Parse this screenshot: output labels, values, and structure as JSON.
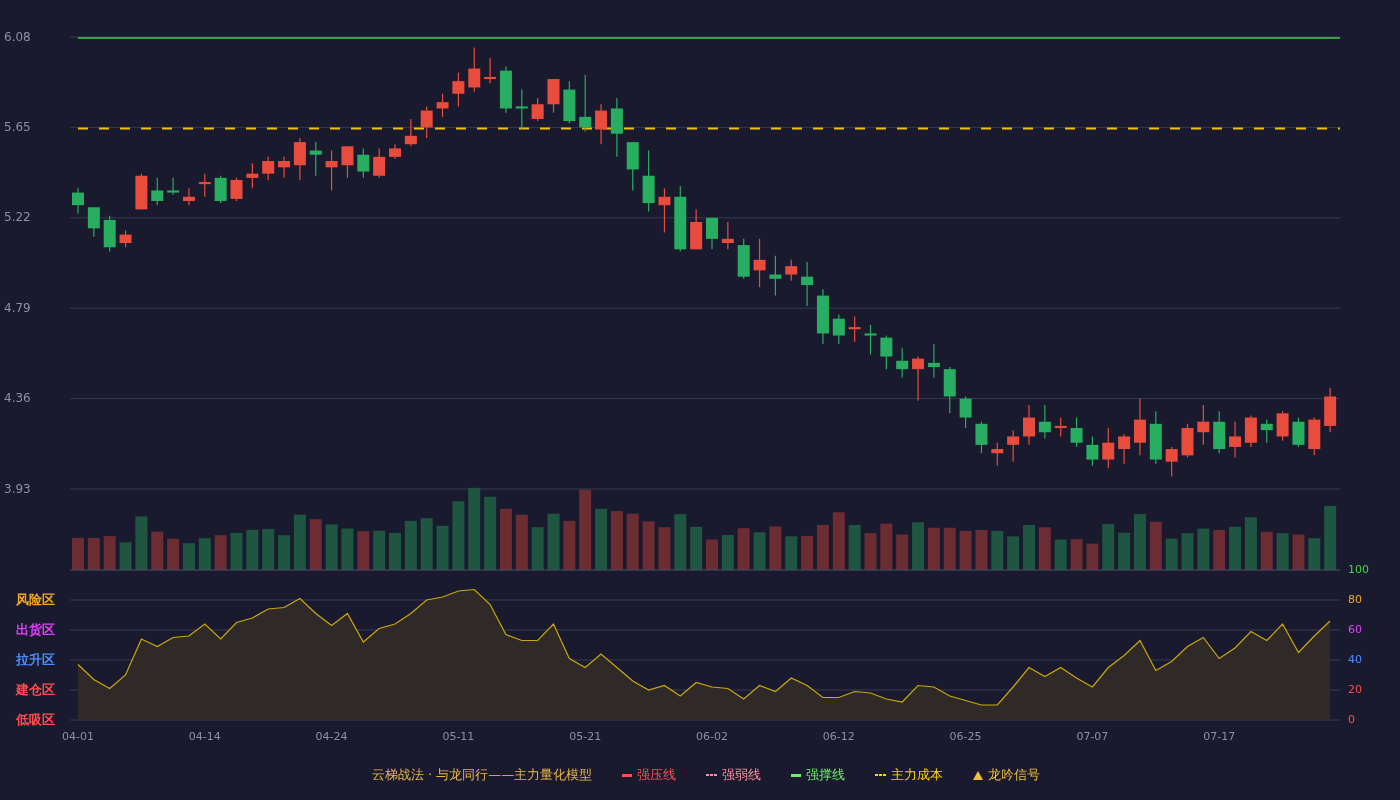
{
  "price_chart": {
    "chart_data": {
      "type": "candlestick",
      "grid": true,
      "ylim": [
        3.93,
        6.08
      ],
      "yticks": [
        6.08,
        5.65,
        5.22,
        4.79,
        4.36,
        3.93
      ],
      "ohlc": [
        [
          5.34,
          5.36,
          5.24,
          5.28
        ],
        [
          5.27,
          5.27,
          5.13,
          5.17
        ],
        [
          5.21,
          5.23,
          5.06,
          5.08
        ],
        [
          5.1,
          5.16,
          5.08,
          5.14
        ],
        [
          5.26,
          5.43,
          5.26,
          5.42
        ],
        [
          5.35,
          5.41,
          5.28,
          5.3
        ],
        [
          5.35,
          5.41,
          5.33,
          5.34
        ],
        [
          5.3,
          5.36,
          5.28,
          5.32
        ],
        [
          5.38,
          5.43,
          5.32,
          5.39
        ],
        [
          5.41,
          5.42,
          5.29,
          5.3
        ],
        [
          5.31,
          5.41,
          5.3,
          5.4
        ],
        [
          5.41,
          5.48,
          5.36,
          5.43
        ],
        [
          5.43,
          5.51,
          5.4,
          5.49
        ],
        [
          5.46,
          5.51,
          5.41,
          5.49
        ],
        [
          5.47,
          5.6,
          5.4,
          5.58
        ],
        [
          5.54,
          5.58,
          5.42,
          5.52
        ],
        [
          5.46,
          5.54,
          5.35,
          5.49
        ],
        [
          5.47,
          5.56,
          5.41,
          5.56
        ],
        [
          5.52,
          5.55,
          5.41,
          5.44
        ],
        [
          5.42,
          5.55,
          5.41,
          5.51
        ],
        [
          5.51,
          5.57,
          5.5,
          5.55
        ],
        [
          5.57,
          5.69,
          5.56,
          5.61
        ],
        [
          5.65,
          5.75,
          5.6,
          5.73
        ],
        [
          5.74,
          5.81,
          5.7,
          5.77
        ],
        [
          5.81,
          5.91,
          5.75,
          5.87
        ],
        [
          5.84,
          6.03,
          5.82,
          5.93
        ],
        [
          5.88,
          5.98,
          5.86,
          5.89
        ],
        [
          5.92,
          5.94,
          5.72,
          5.74
        ],
        [
          5.75,
          5.83,
          5.64,
          5.74
        ],
        [
          5.69,
          5.79,
          5.68,
          5.76
        ],
        [
          5.76,
          5.88,
          5.72,
          5.88
        ],
        [
          5.83,
          5.87,
          5.67,
          5.68
        ],
        [
          5.7,
          5.9,
          5.63,
          5.65
        ],
        [
          5.64,
          5.76,
          5.57,
          5.73
        ],
        [
          5.74,
          5.79,
          5.51,
          5.62
        ],
        [
          5.58,
          5.58,
          5.35,
          5.45
        ],
        [
          5.42,
          5.54,
          5.25,
          5.29
        ],
        [
          5.28,
          5.36,
          5.15,
          5.32
        ],
        [
          5.32,
          5.37,
          5.06,
          5.07
        ],
        [
          5.07,
          5.26,
          5.07,
          5.2
        ],
        [
          5.22,
          5.22,
          5.07,
          5.12
        ],
        [
          5.1,
          5.2,
          5.07,
          5.12
        ],
        [
          5.09,
          5.12,
          4.93,
          4.94
        ],
        [
          4.97,
          5.12,
          4.89,
          5.02
        ],
        [
          4.95,
          5.04,
          4.85,
          4.93
        ],
        [
          4.95,
          5.02,
          4.92,
          4.99
        ],
        [
          4.94,
          5.01,
          4.8,
          4.9
        ],
        [
          4.85,
          4.88,
          4.62,
          4.67
        ],
        [
          4.74,
          4.76,
          4.62,
          4.66
        ],
        [
          4.69,
          4.75,
          4.63,
          4.7
        ],
        [
          4.67,
          4.71,
          4.57,
          4.66
        ],
        [
          4.65,
          4.66,
          4.5,
          4.56
        ],
        [
          4.54,
          4.6,
          4.46,
          4.5
        ],
        [
          4.5,
          4.56,
          4.35,
          4.55
        ],
        [
          4.53,
          4.62,
          4.46,
          4.51
        ],
        [
          4.5,
          4.51,
          4.29,
          4.37
        ],
        [
          4.36,
          4.37,
          4.22,
          4.27
        ],
        [
          4.24,
          4.25,
          4.1,
          4.14
        ],
        [
          4.1,
          4.15,
          4.04,
          4.12
        ],
        [
          4.14,
          4.21,
          4.06,
          4.18
        ],
        [
          4.18,
          4.33,
          4.14,
          4.27
        ],
        [
          4.25,
          4.33,
          4.17,
          4.2
        ],
        [
          4.22,
          4.27,
          4.18,
          4.23
        ],
        [
          4.22,
          4.27,
          4.13,
          4.15
        ],
        [
          4.14,
          4.18,
          4.04,
          4.07
        ],
        [
          4.07,
          4.22,
          4.03,
          4.15
        ],
        [
          4.12,
          4.19,
          4.05,
          4.18
        ],
        [
          4.15,
          4.36,
          4.09,
          4.26
        ],
        [
          4.24,
          4.3,
          4.05,
          4.07
        ],
        [
          4.06,
          4.13,
          3.99,
          4.12
        ],
        [
          4.09,
          4.24,
          4.08,
          4.22
        ],
        [
          4.2,
          4.33,
          4.14,
          4.25
        ],
        [
          4.25,
          4.3,
          4.1,
          4.12
        ],
        [
          4.13,
          4.25,
          4.08,
          4.18
        ],
        [
          4.15,
          4.28,
          4.13,
          4.27
        ],
        [
          4.24,
          4.26,
          4.15,
          4.21
        ],
        [
          4.18,
          4.3,
          4.16,
          4.29
        ],
        [
          4.25,
          4.27,
          4.13,
          4.14
        ],
        [
          4.12,
          4.27,
          4.09,
          4.26
        ],
        [
          4.23,
          4.41,
          4.2,
          4.37
        ]
      ],
      "ref_lines": [
        {
          "axis": "y",
          "value": 6.08,
          "color": "#3a9d48"
        },
        {
          "axis": "y",
          "value": 5.65,
          "color": "#f2c200"
        }
      ]
    }
  },
  "oscillator": {
    "zones": [
      {
        "label": "风险区",
        "color": "#f5a623"
      },
      {
        "label": "出货区",
        "color": "#e040fb"
      },
      {
        "label": "拉升区",
        "color": "#4d8dff"
      },
      {
        "label": "建仓区",
        "color": "#ff4d4f"
      },
      {
        "label": "低吸区",
        "color": "#ff4d4f"
      }
    ],
    "chart_data": {
      "type": "area",
      "grid": true,
      "ylim": [
        0,
        100
      ],
      "yticks": [
        100,
        80,
        60,
        40,
        20,
        0
      ],
      "categories": [
        "04-01",
        null,
        null,
        null,
        null,
        null,
        null,
        null,
        "04-14",
        null,
        null,
        null,
        null,
        null,
        null,
        null,
        "04-24",
        null,
        null,
        null,
        null,
        null,
        null,
        null,
        "05-11",
        null,
        null,
        null,
        null,
        null,
        null,
        null,
        "05-21",
        null,
        null,
        null,
        null,
        null,
        null,
        null,
        "06-02",
        null,
        null,
        null,
        null,
        null,
        null,
        null,
        "06-12",
        null,
        null,
        null,
        null,
        null,
        null,
        null,
        "06-25",
        null,
        null,
        null,
        null,
        null,
        null,
        null,
        "07-07",
        null,
        null,
        null,
        null,
        null,
        null,
        null,
        "07-17",
        null,
        null,
        null,
        null,
        null,
        null,
        null
      ],
      "series": [
        {
          "color": "#c9a80a",
          "values": [
            37,
            27,
            21,
            30,
            54,
            49,
            55,
            56,
            64,
            54,
            65,
            68,
            74,
            75,
            81,
            71,
            63,
            71,
            52,
            61,
            64,
            71,
            80,
            82,
            86,
            87,
            77,
            57,
            53,
            53,
            64,
            41,
            35,
            44,
            35,
            26,
            20,
            23,
            16,
            25,
            22,
            21,
            14,
            23,
            19,
            28,
            23,
            15,
            15,
            19,
            18,
            14,
            12,
            23,
            22,
            16,
            13,
            10,
            10,
            22,
            35,
            29,
            35,
            28,
            22,
            35,
            43,
            53,
            33,
            39,
            49,
            55,
            41,
            48,
            59,
            53,
            64,
            45,
            56,
            66
          ]
        }
      ]
    }
  },
  "legend": {
    "title": "云梯战法 · 与龙同行——主力量化模型",
    "items": [
      {
        "kind": "solid",
        "label": "强压线",
        "color": "#ff4d4f"
      },
      {
        "kind": "dashed",
        "label": "强弱线",
        "color": "#ff8fa3"
      },
      {
        "kind": "solid",
        "label": "强撑线",
        "color": "#6cf06c"
      },
      {
        "kind": "dashed",
        "label": "主力成本",
        "color": "#ffd700"
      },
      {
        "kind": "triangle",
        "label": "龙吟信号",
        "color": "#f0c040"
      }
    ]
  }
}
